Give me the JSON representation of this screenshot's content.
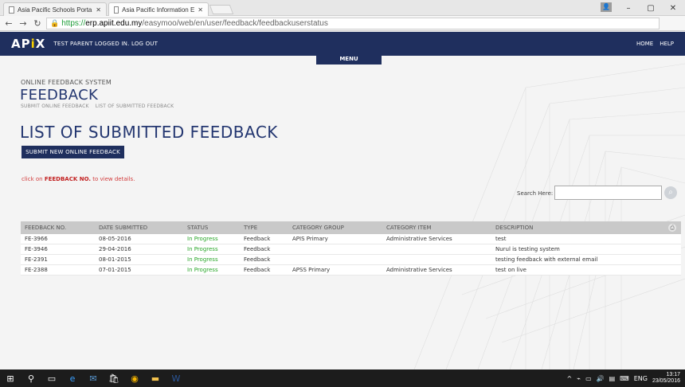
{
  "browser": {
    "tabs": [
      {
        "label": "Asia Pacific Schools Porta"
      },
      {
        "label": "Asia Pacific Information E"
      }
    ],
    "url_https": "https://",
    "url_host": "erp.apiit.edu.my",
    "url_path": "/easymoo/web/en/user/feedback/feedbackuserstatus"
  },
  "header": {
    "logo_left": "AP",
    "logo_i": "i",
    "logo_right": "X",
    "logged_in": "TEST PARENT LOGGED IN.",
    "logout": "LOG OUT",
    "home": "HOME",
    "help": "HELP",
    "menu": "MENU"
  },
  "page": {
    "system_label": "ONLINE FEEDBACK SYSTEM",
    "title": "FEEDBACK",
    "breadcrumb": [
      "SUBMIT ONLINE FEEDBACK",
      "LIST OF SUBMITTED FEEDBACK"
    ],
    "list_title": "LIST OF SUBMITTED FEEDBACK",
    "submit_button": "SUBMIT NEW ONLINE FEEDBACK",
    "hint_prefix": "click on ",
    "hint_bold": "FEEDBACK NO.",
    "hint_suffix": " to view details.",
    "search_label": "Search Here:",
    "search_value": ""
  },
  "table": {
    "headers": [
      "FEEDBACK NO.",
      "DATE SUBMITTED",
      "STATUS",
      "TYPE",
      "CATEGORY GROUP",
      "CATEGORY ITEM",
      "DESCRIPTION"
    ],
    "rows": [
      [
        "FE-3966",
        "08-05-2016",
        "In Progress",
        "Feedback",
        "APIS Primary",
        "Administrative Services",
        "test"
      ],
      [
        "FE-3946",
        "29-04-2016",
        "In Progress",
        "Feedback",
        "",
        "",
        "Nurul is testing system"
      ],
      [
        "FE-2391",
        "08-01-2015",
        "In Progress",
        "Feedback",
        "",
        "",
        "testing feedback with external email"
      ],
      [
        "FE-2388",
        "07-01-2015",
        "In Progress",
        "Feedback",
        "APSS Primary",
        "Administrative Services",
        "test on live"
      ]
    ]
  },
  "taskbar": {
    "lang": "ENG",
    "time": "13:17",
    "date": "23/05/2016"
  },
  "colors": {
    "navy": "#1f2f5e",
    "status_green": "#28a628",
    "hint_red": "#c21f1f"
  }
}
